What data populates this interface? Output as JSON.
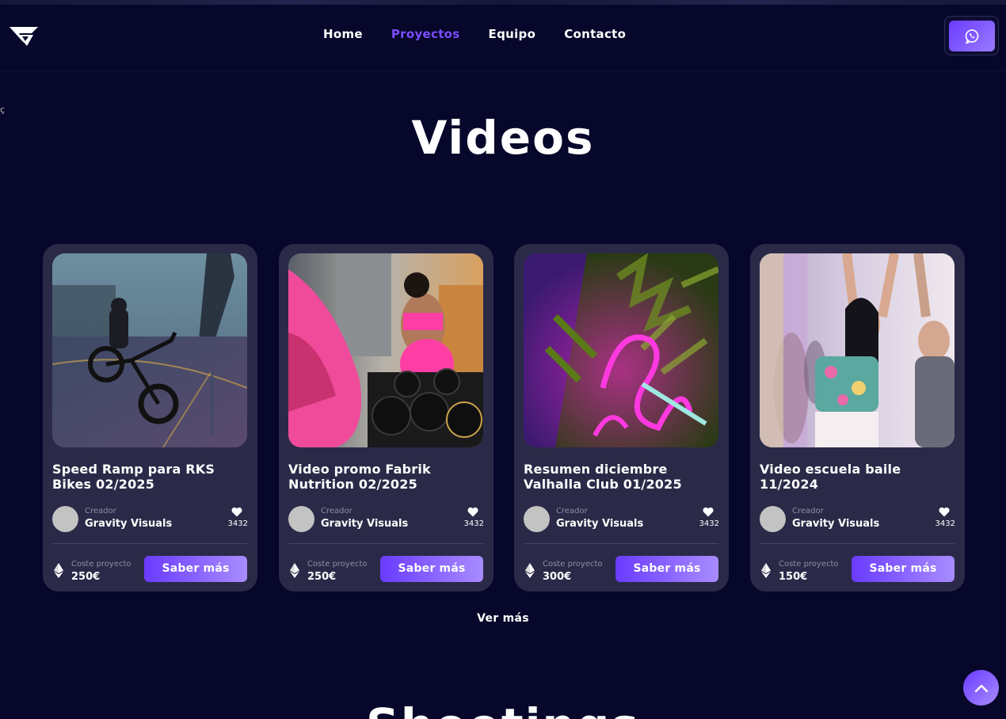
{
  "nav": {
    "items": [
      {
        "label": "Home",
        "active": false
      },
      {
        "label": "Proyectos",
        "active": true
      },
      {
        "label": "Equipo",
        "active": false
      },
      {
        "label": "Contacto",
        "active": false
      }
    ],
    "whatsapp_icon": "whatsapp-icon",
    "logo_icon": "gravity-logo"
  },
  "edge_glyph": "ç",
  "section": {
    "title": "Videos"
  },
  "cards": [
    {
      "title": "Speed Ramp para RKS Bikes 02/2025",
      "creator_label": "Creador",
      "creator_name": "Gravity Visuals",
      "likes": "3432",
      "cost_label": "Coste proyecto",
      "cost": "250€",
      "button": "Saber más"
    },
    {
      "title": "Video promo Fabrik Nutrition 02/2025",
      "creator_label": "Creador",
      "creator_name": "Gravity Visuals",
      "likes": "3432",
      "cost_label": "Coste proyecto",
      "cost": "250€",
      "button": "Saber más"
    },
    {
      "title": "Resumen diciembre Valhalla Club 01/2025",
      "creator_label": "Creador",
      "creator_name": "Gravity Visuals",
      "likes": "3432",
      "cost_label": "Coste proyecto",
      "cost": "300€",
      "button": "Saber más"
    },
    {
      "title": "Video escuela baile 11/2024",
      "creator_label": "Creador",
      "creator_name": "Gravity Visuals",
      "likes": "3432",
      "cost_label": "Coste proyecto",
      "cost": "150€",
      "button": "Saber más"
    }
  ],
  "ver_mas": "Ver más",
  "next_section": {
    "title": "Shootings"
  },
  "colors": {
    "background": "#07072b",
    "card": "#2a2a48",
    "accent": "#7b4dff",
    "accent_light": "#a88cff"
  }
}
